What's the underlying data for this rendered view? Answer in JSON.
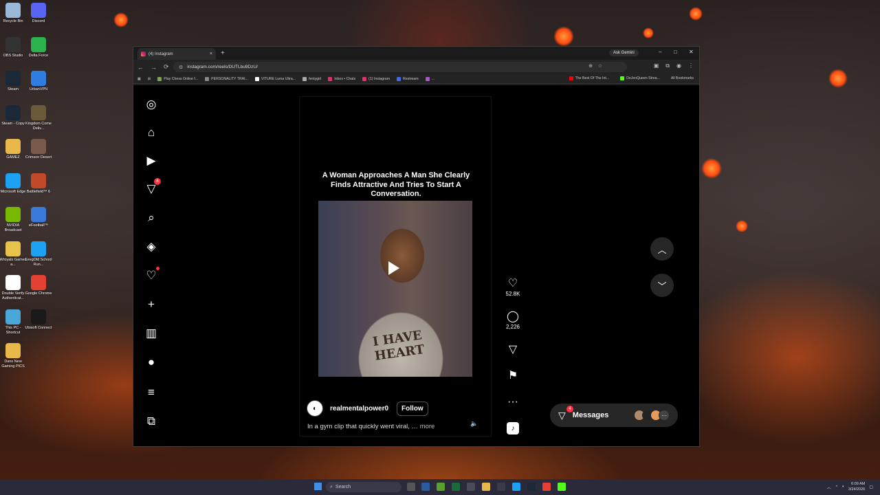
{
  "desktop": {
    "icons": [
      {
        "label": "Recycle Bin",
        "color": "#9ab8d8"
      },
      {
        "label": "Discord",
        "color": "#5865f2"
      },
      {
        "label": "OBS Studio",
        "color": "#333333"
      },
      {
        "label": "Delta Force",
        "color": "#2bb24c"
      },
      {
        "label": "Steam",
        "color": "#1b2838"
      },
      {
        "label": "UrbanVPN",
        "color": "#2f7de1"
      },
      {
        "label": "Steam - Copy",
        "color": "#1b2838"
      },
      {
        "label": "Kingdom Come Deliv...",
        "color": "#6b5a3a"
      },
      {
        "label": "GAMEZ",
        "color": "#e8b84a"
      },
      {
        "label": "Crimson Desert",
        "color": "#7a5a4a"
      },
      {
        "label": "Microsoft Edge",
        "color": "#1da1f2"
      },
      {
        "label": "Battlefield™ 6",
        "color": "#c24a2a"
      },
      {
        "label": "NVIDIA Broadcast",
        "color": "#76b900"
      },
      {
        "label": "eFootball™",
        "color": "#3a7ad8"
      },
      {
        "label": "Wroyals Games a...",
        "color": "#e8c24a"
      },
      {
        "label": "GregOld School Run...",
        "color": "#1da1f2"
      },
      {
        "label": "Double Verify Authenticat...",
        "color": "#ffffff"
      },
      {
        "label": "Google Chrome",
        "color": "#e44134"
      },
      {
        "label": "This PC - Shortcut",
        "color": "#4aa8d8"
      },
      {
        "label": "Ubisoft Connect",
        "color": "#1a1a1a"
      },
      {
        "label": "Dans New Gaming PICS",
        "color": "#e8b84a"
      }
    ]
  },
  "browser": {
    "tab_title": "(4) Instagram",
    "tab_close": "×",
    "new_tab": "+",
    "ask_gemini": "Ask Gemini",
    "minimize": "–",
    "maximize": "□",
    "close": "✕",
    "back": "←",
    "forward": "→",
    "reload": "⟳",
    "url": "instagram.com/reels/DUTLbu9DzU/",
    "bookmarks": [
      {
        "label": "Play Chess Online f...",
        "color": "#7fa650"
      },
      {
        "label": "PERSONALITY TRAI...",
        "color": "#888888"
      },
      {
        "label": "VITURE Luma Ultra...",
        "color": "#ffffff"
      },
      {
        "label": "fentygirl",
        "color": "#aaaaaa"
      },
      {
        "label": "Inbox • Chats",
        "color": "#e1306c"
      },
      {
        "label": "(1) Instagram",
        "color": "#e1306c"
      },
      {
        "label": "Restream",
        "color": "#3a6ee8"
      },
      {
        "label": "...",
        "color": "#aa55cc"
      }
    ],
    "bookmarks_right": [
      {
        "label": "The Best Of The Int...",
        "color": "#ff0000"
      },
      {
        "label": "DeJenQueen Strea...",
        "color": "#53fc18"
      }
    ],
    "all_bookmarks": "All Bookmarks"
  },
  "instagram": {
    "nav": [
      {
        "name": "instagram-logo-icon",
        "glyph": "◎"
      },
      {
        "name": "home-icon",
        "glyph": "⌂"
      },
      {
        "name": "reels-icon",
        "glyph": "▶"
      },
      {
        "name": "direct-messages-icon",
        "glyph": "▽",
        "badge": "6"
      },
      {
        "name": "search-icon",
        "glyph": "⌕"
      },
      {
        "name": "explore-icon",
        "glyph": "◈"
      },
      {
        "name": "notifications-heart-icon",
        "glyph": "♡"
      },
      {
        "name": "create-plus-icon",
        "glyph": "+"
      },
      {
        "name": "dashboard-icon",
        "glyph": "▥"
      },
      {
        "name": "profile-avatar",
        "glyph": "●"
      },
      {
        "name": "menu-hamburger-icon",
        "glyph": "≡"
      },
      {
        "name": "also-from-meta-icon",
        "glyph": "⧉"
      }
    ],
    "reel": {
      "caption_overlay": "A Woman Approaches A Man She Clearly Finds Attractive And Tries To Start A Conversation.",
      "shirt_text": "I HAVE HEART",
      "username": "realmentalpower0",
      "follow_label": "Follow",
      "description": "In a gym clip that quickly went viral, …",
      "more_label": "more",
      "likes": "52.8K",
      "comments": "2,226"
    },
    "messages": {
      "label": "Messages",
      "badge": "4",
      "more": "···"
    }
  },
  "taskbar": {
    "search_placeholder": "Search",
    "time": "6:09 AM",
    "date": "3/24/2026"
  }
}
